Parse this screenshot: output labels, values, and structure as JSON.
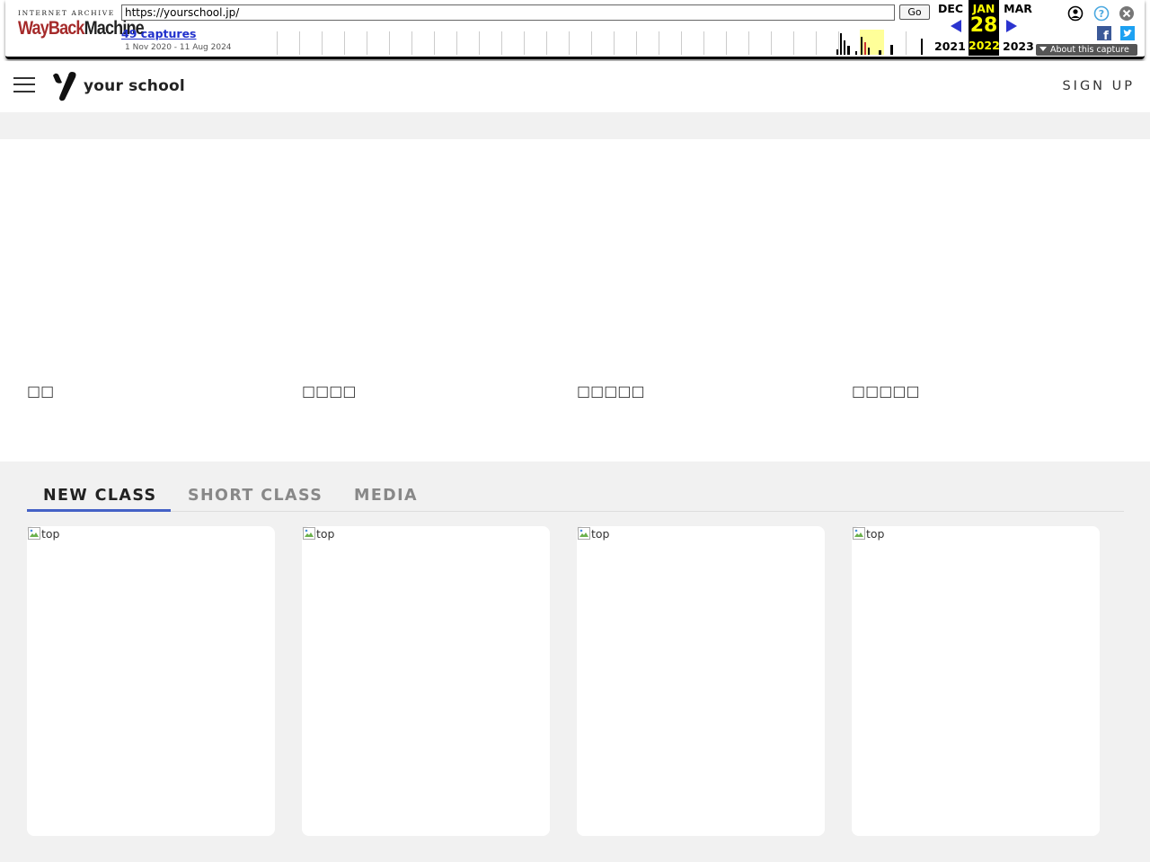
{
  "wayback": {
    "logo_top": "INTERNET ARCHIVE",
    "logo_main_a": "WayBack",
    "logo_main_b": "Machine",
    "url": "https://yourschool.jp/",
    "go_label": "Go",
    "captures": "49 captures",
    "range": "1 Nov 2020 - 11 Aug 2024",
    "prev_month": "DEC",
    "prev_year": "2021",
    "current_month": "JAN",
    "current_day": "28",
    "current_year": "2022",
    "next_month": "MAR",
    "next_year": "2023",
    "about_label": "About this capture",
    "icons": [
      "user-icon",
      "help-icon",
      "close-icon",
      "facebook-icon",
      "twitter-icon"
    ]
  },
  "header": {
    "logo_text": "your school",
    "signup_label": "SIGN UP"
  },
  "tabs": [
    {
      "label": "NEW CLASS",
      "active": true
    },
    {
      "label": "SHORT CLASS",
      "active": false
    },
    {
      "label": "MEDIA",
      "active": false
    }
  ],
  "cards": [
    {
      "img_alt": "top",
      "title": "□□"
    },
    {
      "img_alt": "top",
      "title": "□□□□"
    },
    {
      "img_alt": "top",
      "title": "□□□□□"
    },
    {
      "img_alt": "top",
      "title": "□□□□□"
    }
  ],
  "colors": {
    "accent": "#4461c6",
    "wayback_highlight": "#ffff00",
    "wayback_link": "#2030cc"
  }
}
